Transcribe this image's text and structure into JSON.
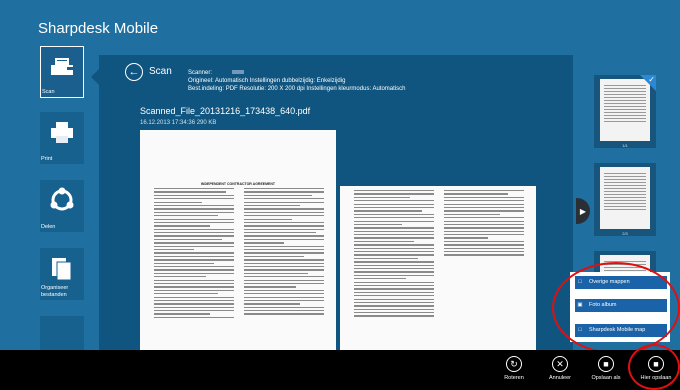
{
  "app": {
    "title": "Sharpdesk Mobile"
  },
  "nav": {
    "items": [
      {
        "label": "Scan",
        "icon": "scanner-icon"
      },
      {
        "label": "Print",
        "icon": "printer-icon"
      },
      {
        "label": "Delen",
        "icon": "share-icon"
      },
      {
        "label": "Organiseer bestanden",
        "icon": "files-icon"
      },
      {
        "label": "",
        "icon": "gear-icon"
      }
    ]
  },
  "scan": {
    "title": "Scan",
    "scanner_label": "Scanner:",
    "scanner_value": "",
    "line2": "Origineel: Automatisch   Instellingen dubbelzijdig: Enkelzijdig",
    "line3": "Best.indeling: PDF   Resolutie: 200 X 200 dpi   Instellingen kleurmodus: Automatisch",
    "file_name": "Scanned_File_20131216_173438_640.pdf",
    "file_date": "16.12.2013 17:34:36 290 KB",
    "page_heading": "INDEPENDENT CONTRACTOR AGREEMENT"
  },
  "thumbnails": [
    {
      "num": "1/1"
    },
    {
      "num": "2/3"
    },
    {
      "num": ""
    }
  ],
  "popup": {
    "items": [
      {
        "label": "Overige mappen",
        "icon": "folder-icon"
      },
      {
        "label": "Foto album",
        "icon": "photo-icon"
      },
      {
        "label": "Sharpdesk Mobile map",
        "icon": "folder-icon"
      }
    ]
  },
  "appbar": {
    "rotate": "Roteren",
    "cancel": "Annuleer",
    "save": "Opslaan als",
    "save_in": "Hier opslaan"
  },
  "colors": {
    "background": "#1f6fa0",
    "panel": "#10557f",
    "accent": "#1b63a8",
    "highlight": "#e20f0f"
  }
}
